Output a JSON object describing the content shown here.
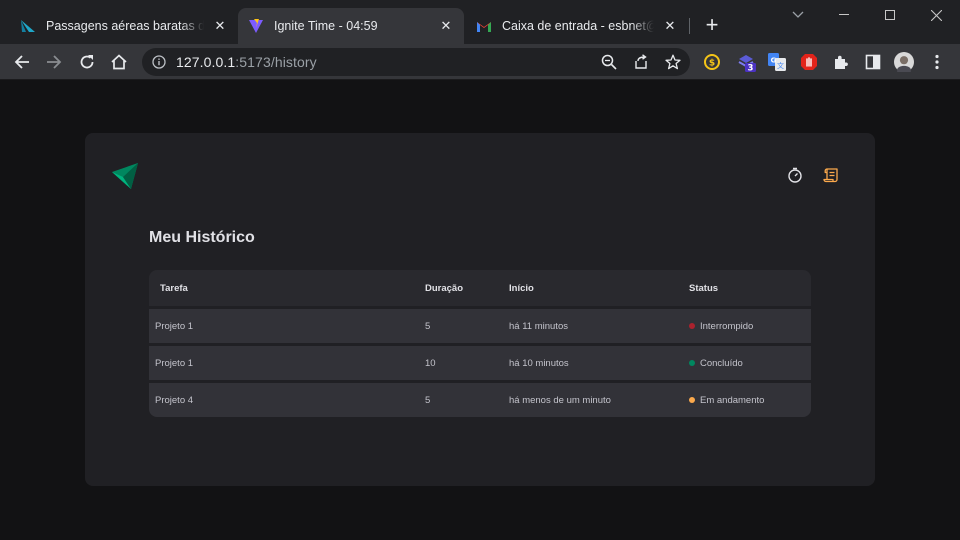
{
  "browser": {
    "tabs": [
      {
        "title": "Passagens aéreas baratas de BH",
        "active": false,
        "icon": "airline-favicon"
      },
      {
        "title": "Ignite Time - 04:59",
        "active": true,
        "icon": "vite-favicon"
      },
      {
        "title": "Caixa de entrada - esbnet@gmail.com",
        "active": false,
        "icon": "gmail-favicon"
      }
    ],
    "url_host": "127.0.0.1",
    "url_rest": ":5173/history",
    "extension_badge": "3"
  },
  "app": {
    "title": "Meu Histórico",
    "table": {
      "headers": [
        "Tarefa",
        "Duração",
        "Início",
        "Status"
      ],
      "rows": [
        {
          "task": "Projeto 1",
          "duration": "5",
          "start": "há 11 minutos",
          "status": "Interrompido",
          "status_color": "#ab222e"
        },
        {
          "task": "Projeto 1",
          "duration": "10",
          "start": "há 10 minutos",
          "status": "Concluído",
          "status_color": "#00875f"
        },
        {
          "task": "Projeto 4",
          "duration": "5",
          "start": "há menos de um minuto",
          "status": "Em andamento",
          "status_color": "#fba94c"
        }
      ]
    }
  },
  "colors": {
    "accent": "#00875f",
    "nav_active": "#fba94c"
  }
}
